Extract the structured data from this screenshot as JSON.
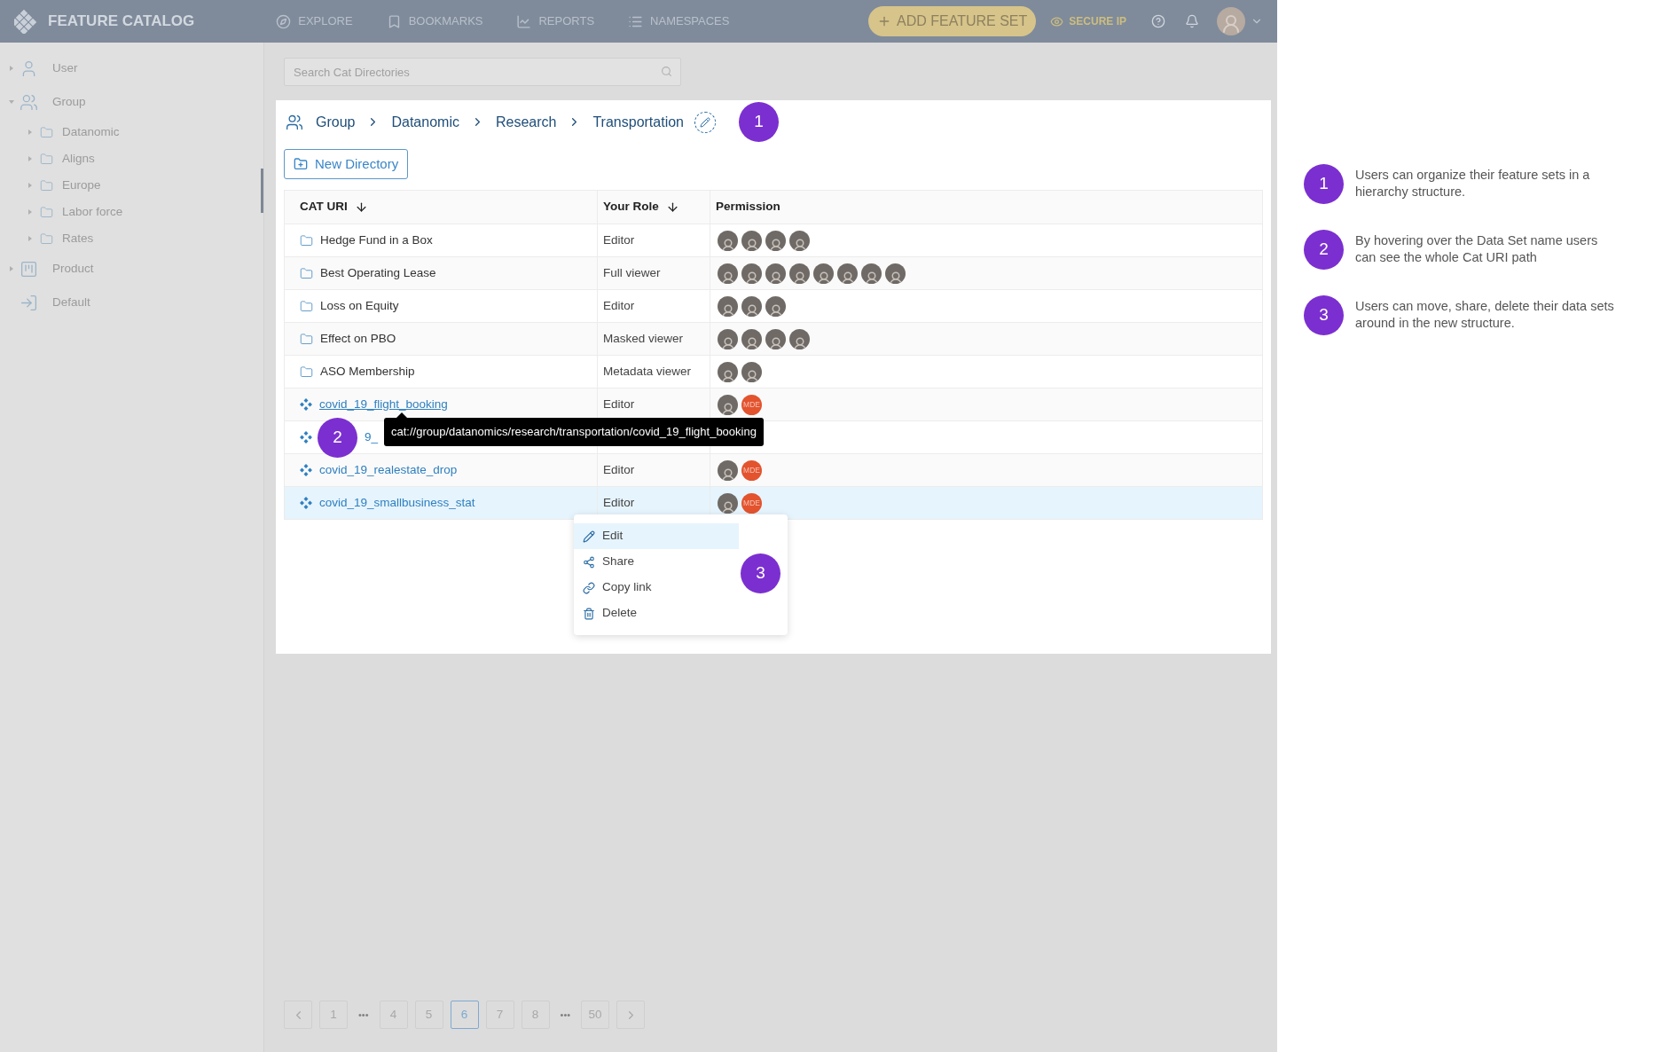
{
  "nav": {
    "brand": "FEATURE CATALOG",
    "items": [
      {
        "label": "EXPLORE"
      },
      {
        "label": "BOOKMARKS"
      },
      {
        "label": "REPORTS"
      },
      {
        "label": "NAMESPACES"
      }
    ],
    "add_button": "ADD FEATURE SET",
    "secure_link": "SECURE IP"
  },
  "sidebar": {
    "items": [
      {
        "label": "User",
        "expanded": false
      },
      {
        "label": "Group",
        "expanded": true,
        "children": [
          {
            "label": "Datanomic",
            "expanded": false
          },
          {
            "label": "Aligns",
            "expanded": false
          },
          {
            "label": "Europe",
            "expanded": false
          },
          {
            "label": "Labor force",
            "expanded": false
          },
          {
            "label": "Rates",
            "expanded": false
          }
        ]
      },
      {
        "label": "Product",
        "expanded": false
      },
      {
        "label": "Default"
      }
    ]
  },
  "search": {
    "placeholder": "Search Cat Directories"
  },
  "breadcrumb": {
    "items": [
      "Group",
      "Datanomic",
      "Research",
      "Transportation"
    ],
    "callout": "1"
  },
  "new_directory_button": "New Directory",
  "table": {
    "columns": [
      {
        "label": "CAT URI",
        "sortable": true
      },
      {
        "label": "Your Role",
        "sortable": true
      },
      {
        "label": "Permission",
        "sortable": false
      }
    ],
    "rows": [
      {
        "kind": "folder",
        "name": "Hedge Fund in a Box",
        "role": "Editor",
        "selected": false,
        "avatars": [
          {
            "kind": "photo"
          },
          {
            "kind": "photo"
          },
          {
            "kind": "photo"
          },
          {
            "kind": "photo"
          }
        ]
      },
      {
        "kind": "folder",
        "name": "Best Operating Lease",
        "role": "Full viewer",
        "selected": false,
        "avatars": [
          {
            "kind": "photo"
          },
          {
            "kind": "photo"
          },
          {
            "kind": "photo"
          },
          {
            "kind": "photo"
          },
          {
            "kind": "photo"
          },
          {
            "kind": "photo"
          },
          {
            "kind": "photo"
          },
          {
            "kind": "photo"
          }
        ]
      },
      {
        "kind": "folder",
        "name": "Loss on Equity",
        "role": "Editor",
        "selected": false,
        "avatars": [
          {
            "kind": "photo"
          },
          {
            "kind": "photo"
          },
          {
            "kind": "photo"
          }
        ]
      },
      {
        "kind": "folder",
        "name": "Effect on PBO",
        "role": "Masked viewer",
        "selected": false,
        "avatars": [
          {
            "kind": "photo"
          },
          {
            "kind": "photo"
          },
          {
            "kind": "photo"
          },
          {
            "kind": "photo"
          }
        ]
      },
      {
        "kind": "folder",
        "name": "ASO Membership",
        "role": "Metadata viewer",
        "selected": false,
        "avatars": [
          {
            "kind": "photo"
          },
          {
            "kind": "photo"
          }
        ]
      },
      {
        "kind": "dataset",
        "name": "covid_19_flight_booking",
        "role": "Editor",
        "selected": false,
        "avatars": [
          {
            "kind": "photo"
          },
          {
            "kind": "initials",
            "text": "MDE"
          }
        ]
      },
      {
        "kind": "dataset",
        "name": "9_",
        "callout": "2",
        "selected": false
      },
      {
        "kind": "dataset",
        "name": "covid_19_realestate_drop",
        "role": "Editor",
        "selected": false,
        "avatars": [
          {
            "kind": "photo"
          },
          {
            "kind": "initials",
            "text": "MDE"
          }
        ]
      },
      {
        "kind": "dataset",
        "name": "covid_19_smallbusiness_stat",
        "role": "Editor",
        "selected": true,
        "avatars": [
          {
            "kind": "photo"
          },
          {
            "kind": "initials",
            "text": "MDE"
          }
        ]
      }
    ]
  },
  "tooltip": "cat://group/datanomics/research/transportation/covid_19_flight_booking",
  "context_menu": {
    "callout": "3",
    "items": [
      {
        "label": "Edit",
        "selected": true
      },
      {
        "label": "Share",
        "selected": false
      },
      {
        "label": "Copy link",
        "selected": false
      },
      {
        "label": "Delete",
        "selected": false
      }
    ]
  },
  "pagination": [
    {
      "kind": "prev"
    },
    {
      "kind": "page",
      "label": "1",
      "selected": false
    },
    {
      "kind": "ellipsis",
      "label": "•••"
    },
    {
      "kind": "page",
      "label": "4",
      "selected": false
    },
    {
      "kind": "page",
      "label": "5",
      "selected": false
    },
    {
      "kind": "page",
      "label": "6",
      "selected": true
    },
    {
      "kind": "page",
      "label": "7",
      "selected": false
    },
    {
      "kind": "page",
      "label": "8",
      "selected": false
    },
    {
      "kind": "ellipsis",
      "label": "•••"
    },
    {
      "kind": "page",
      "label": "50",
      "selected": false
    },
    {
      "kind": "next"
    }
  ],
  "annotations": [
    {
      "number": "1",
      "text": "Users can organize their feature sets in a hierarchy structure."
    },
    {
      "number": "2",
      "text": "By hovering over the Data Set name users can see the whole Cat URI path"
    },
    {
      "number": "3",
      "text": "Users can move, share, delete their data sets around in the new structure."
    }
  ]
}
